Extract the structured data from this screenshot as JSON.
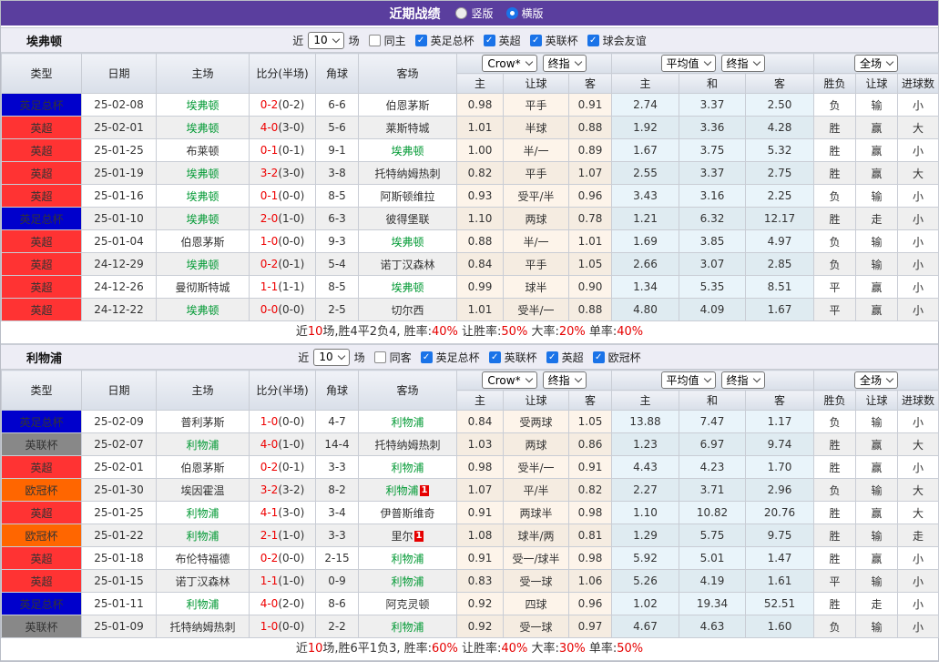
{
  "header": {
    "title": "近期战绩",
    "radio_vertical": "竖版",
    "radio_horizontal": "横版",
    "vertical_checked": false,
    "horizontal_checked": true
  },
  "table": {
    "columns_left": [
      "类型",
      "日期",
      "主场",
      "比分(半场)",
      "角球",
      "客场"
    ],
    "columns_sub": [
      "主",
      "让球",
      "客",
      "主",
      "和",
      "客",
      "胜负",
      "让球",
      "进球数"
    ],
    "selects": {
      "odds_group": [
        "Crow*",
        "终指"
      ],
      "avg_group": [
        "平均值",
        "终指"
      ],
      "scope_group": [
        "全场"
      ]
    }
  },
  "league_colors": {
    "英足总杯": "#0000cc",
    "英超": "#ff3333",
    "英联杯": "#888888",
    "欧冠杯": "#ff6600"
  },
  "result_colors": {
    "r": "#e60000",
    "b": "#3333cc",
    "g": "#009933"
  },
  "sections": [
    {
      "team": "埃弗顿",
      "filter": {
        "near": "近",
        "count": "10",
        "unit": "场",
        "same": "同主",
        "same_checked": false,
        "leagues": [
          "英足总杯",
          "英超",
          "英联杯",
          "球会友谊"
        ]
      },
      "rows": [
        {
          "league": "英足总杯",
          "date": "25-02-08",
          "home": "埃弗顿",
          "home_hl": true,
          "home_tag": "",
          "score": "0-2",
          "half": "(0-2)",
          "corners": "6-6",
          "away": "伯恩茅斯",
          "away_hl": false,
          "away_tag": "",
          "odds": [
            "0.98",
            "平手",
            "0.91"
          ],
          "avg": [
            "2.74",
            "3.37",
            "2.50"
          ],
          "res": [
            [
              "负",
              "b"
            ],
            [
              "输",
              "b"
            ],
            [
              "小",
              "b"
            ]
          ]
        },
        {
          "league": "英超",
          "date": "25-02-01",
          "home": "埃弗顿",
          "home_hl": true,
          "home_tag": "",
          "score": "4-0",
          "half": "(3-0)",
          "corners": "5-6",
          "away": "莱斯特城",
          "away_hl": false,
          "away_tag": "",
          "odds": [
            "1.01",
            "半球",
            "0.88"
          ],
          "avg": [
            "1.92",
            "3.36",
            "4.28"
          ],
          "res": [
            [
              "胜",
              "r"
            ],
            [
              "赢",
              "r"
            ],
            [
              "大",
              "r"
            ]
          ]
        },
        {
          "league": "英超",
          "date": "25-01-25",
          "home": "布莱顿",
          "home_hl": false,
          "home_tag": "",
          "score": "0-1",
          "half": "(0-1)",
          "corners": "9-1",
          "away": "埃弗顿",
          "away_hl": true,
          "away_tag": "",
          "odds": [
            "1.00",
            "半/一",
            "0.89"
          ],
          "avg": [
            "1.67",
            "3.75",
            "5.32"
          ],
          "res": [
            [
              "胜",
              "r"
            ],
            [
              "赢",
              "r"
            ],
            [
              "小",
              "b"
            ]
          ]
        },
        {
          "league": "英超",
          "date": "25-01-19",
          "home": "埃弗顿",
          "home_hl": true,
          "home_tag": "",
          "score": "3-2",
          "half": "(3-0)",
          "corners": "3-8",
          "away": "托特纳姆热刺",
          "away_hl": false,
          "away_tag": "",
          "odds": [
            "0.82",
            "平手",
            "1.07"
          ],
          "avg": [
            "2.55",
            "3.37",
            "2.75"
          ],
          "res": [
            [
              "胜",
              "r"
            ],
            [
              "赢",
              "r"
            ],
            [
              "大",
              "r"
            ]
          ]
        },
        {
          "league": "英超",
          "date": "25-01-16",
          "home": "埃弗顿",
          "home_hl": true,
          "home_tag": "",
          "score": "0-1",
          "half": "(0-0)",
          "corners": "8-5",
          "away": "阿斯顿维拉",
          "away_hl": false,
          "away_tag": "",
          "odds": [
            "0.93",
            "受平/半",
            "0.96"
          ],
          "avg": [
            "3.43",
            "3.16",
            "2.25"
          ],
          "res": [
            [
              "负",
              "b"
            ],
            [
              "输",
              "b"
            ],
            [
              "小",
              "b"
            ]
          ]
        },
        {
          "league": "英足总杯",
          "date": "25-01-10",
          "home": "埃弗顿",
          "home_hl": true,
          "home_tag": "",
          "score": "2-0",
          "half": "(1-0)",
          "corners": "6-3",
          "away": "彼得堡联",
          "away_hl": false,
          "away_tag": "",
          "odds": [
            "1.10",
            "两球",
            "0.78"
          ],
          "avg": [
            "1.21",
            "6.32",
            "12.17"
          ],
          "res": [
            [
              "胜",
              "r"
            ],
            [
              "走",
              "g"
            ],
            [
              "小",
              "b"
            ]
          ]
        },
        {
          "league": "英超",
          "date": "25-01-04",
          "home": "伯恩茅斯",
          "home_hl": false,
          "home_tag": "",
          "score": "1-0",
          "half": "(0-0)",
          "corners": "9-3",
          "away": "埃弗顿",
          "away_hl": true,
          "away_tag": "",
          "odds": [
            "0.88",
            "半/一",
            "1.01"
          ],
          "avg": [
            "1.69",
            "3.85",
            "4.97"
          ],
          "res": [
            [
              "负",
              "b"
            ],
            [
              "输",
              "b"
            ],
            [
              "小",
              "b"
            ]
          ]
        },
        {
          "league": "英超",
          "date": "24-12-29",
          "home": "埃弗顿",
          "home_hl": true,
          "home_tag": "",
          "score": "0-2",
          "half": "(0-1)",
          "corners": "5-4",
          "away": "诺丁汉森林",
          "away_hl": false,
          "away_tag": "",
          "odds": [
            "0.84",
            "平手",
            "1.05"
          ],
          "avg": [
            "2.66",
            "3.07",
            "2.85"
          ],
          "res": [
            [
              "负",
              "b"
            ],
            [
              "输",
              "b"
            ],
            [
              "小",
              "b"
            ]
          ]
        },
        {
          "league": "英超",
          "date": "24-12-26",
          "home": "曼彻斯特城",
          "home_hl": false,
          "home_tag": "",
          "score": "1-1",
          "half": "(1-1)",
          "corners": "8-5",
          "away": "埃弗顿",
          "away_hl": true,
          "away_tag": "",
          "odds": [
            "0.99",
            "球半",
            "0.90"
          ],
          "avg": [
            "1.34",
            "5.35",
            "8.51"
          ],
          "res": [
            [
              "平",
              "g"
            ],
            [
              "赢",
              "r"
            ],
            [
              "小",
              "b"
            ]
          ]
        },
        {
          "league": "英超",
          "date": "24-12-22",
          "home": "埃弗顿",
          "home_hl": true,
          "home_tag": "",
          "score": "0-0",
          "half": "(0-0)",
          "corners": "2-5",
          "away": "切尔西",
          "away_hl": false,
          "away_tag": "",
          "odds": [
            "1.01",
            "受半/一",
            "0.88"
          ],
          "avg": [
            "4.80",
            "4.09",
            "1.67"
          ],
          "res": [
            [
              "平",
              "g"
            ],
            [
              "赢",
              "r"
            ],
            [
              "小",
              "b"
            ]
          ]
        }
      ],
      "summary": [
        [
          "近",
          0
        ],
        [
          "10",
          1
        ],
        [
          "场,胜4平2负4, 胜率:",
          0
        ],
        [
          "40%",
          1
        ],
        [
          " 让胜率:",
          0
        ],
        [
          "50%",
          1
        ],
        [
          " 大率:",
          0
        ],
        [
          "20%",
          1
        ],
        [
          " 单率:",
          0
        ],
        [
          "40%",
          1
        ]
      ]
    },
    {
      "team": "利物浦",
      "filter": {
        "near": "近",
        "count": "10",
        "unit": "场",
        "same": "同客",
        "same_checked": false,
        "leagues": [
          "英足总杯",
          "英联杯",
          "英超",
          "欧冠杯"
        ]
      },
      "rows": [
        {
          "league": "英足总杯",
          "date": "25-02-09",
          "home": "普利茅斯",
          "home_hl": false,
          "home_tag": "",
          "score": "1-0",
          "half": "(0-0)",
          "corners": "4-7",
          "away": "利物浦",
          "away_hl": true,
          "away_tag": "",
          "odds": [
            "0.84",
            "受两球",
            "1.05"
          ],
          "avg": [
            "13.88",
            "7.47",
            "1.17"
          ],
          "res": [
            [
              "负",
              "b"
            ],
            [
              "输",
              "b"
            ],
            [
              "小",
              "b"
            ]
          ]
        },
        {
          "league": "英联杯",
          "date": "25-02-07",
          "home": "利物浦",
          "home_hl": true,
          "home_tag": "",
          "score": "4-0",
          "half": "(1-0)",
          "corners": "14-4",
          "away": "托特纳姆热刺",
          "away_hl": false,
          "away_tag": "",
          "odds": [
            "1.03",
            "两球",
            "0.86"
          ],
          "avg": [
            "1.23",
            "6.97",
            "9.74"
          ],
          "res": [
            [
              "胜",
              "r"
            ],
            [
              "赢",
              "r"
            ],
            [
              "大",
              "r"
            ]
          ]
        },
        {
          "league": "英超",
          "date": "25-02-01",
          "home": "伯恩茅斯",
          "home_hl": false,
          "home_tag": "",
          "score": "0-2",
          "half": "(0-1)",
          "corners": "3-3",
          "away": "利物浦",
          "away_hl": true,
          "away_tag": "",
          "odds": [
            "0.98",
            "受半/一",
            "0.91"
          ],
          "avg": [
            "4.43",
            "4.23",
            "1.70"
          ],
          "res": [
            [
              "胜",
              "r"
            ],
            [
              "赢",
              "r"
            ],
            [
              "小",
              "b"
            ]
          ]
        },
        {
          "league": "欧冠杯",
          "date": "25-01-30",
          "home": "埃因霍温",
          "home_hl": false,
          "home_tag": "",
          "score": "3-2",
          "half": "(3-2)",
          "corners": "8-2",
          "away": "利物浦",
          "away_hl": true,
          "away_tag": "1",
          "odds": [
            "1.07",
            "平/半",
            "0.82"
          ],
          "avg": [
            "2.27",
            "3.71",
            "2.96"
          ],
          "res": [
            [
              "负",
              "b"
            ],
            [
              "输",
              "b"
            ],
            [
              "大",
              "r"
            ]
          ]
        },
        {
          "league": "英超",
          "date": "25-01-25",
          "home": "利物浦",
          "home_hl": true,
          "home_tag": "",
          "score": "4-1",
          "half": "(3-0)",
          "corners": "3-4",
          "away": "伊普斯维奇",
          "away_hl": false,
          "away_tag": "",
          "odds": [
            "0.91",
            "两球半",
            "0.98"
          ],
          "avg": [
            "1.10",
            "10.82",
            "20.76"
          ],
          "res": [
            [
              "胜",
              "r"
            ],
            [
              "赢",
              "r"
            ],
            [
              "大",
              "r"
            ]
          ]
        },
        {
          "league": "欧冠杯",
          "date": "25-01-22",
          "home": "利物浦",
          "home_hl": true,
          "home_tag": "",
          "score": "2-1",
          "half": "(1-0)",
          "corners": "3-3",
          "away": "里尔",
          "away_hl": false,
          "away_tag": "1",
          "odds": [
            "1.08",
            "球半/两",
            "0.81"
          ],
          "avg": [
            "1.29",
            "5.75",
            "9.75"
          ],
          "res": [
            [
              "胜",
              "r"
            ],
            [
              "输",
              "b"
            ],
            [
              "走",
              "g"
            ]
          ]
        },
        {
          "league": "英超",
          "date": "25-01-18",
          "home": "布伦特福德",
          "home_hl": false,
          "home_tag": "",
          "score": "0-2",
          "half": "(0-0)",
          "corners": "2-15",
          "away": "利物浦",
          "away_hl": true,
          "away_tag": "",
          "odds": [
            "0.91",
            "受一/球半",
            "0.98"
          ],
          "avg": [
            "5.92",
            "5.01",
            "1.47"
          ],
          "res": [
            [
              "胜",
              "r"
            ],
            [
              "赢",
              "r"
            ],
            [
              "小",
              "b"
            ]
          ]
        },
        {
          "league": "英超",
          "date": "25-01-15",
          "home": "诺丁汉森林",
          "home_hl": false,
          "home_tag": "",
          "score": "1-1",
          "half": "(1-0)",
          "corners": "0-9",
          "away": "利物浦",
          "away_hl": true,
          "away_tag": "",
          "odds": [
            "0.83",
            "受一球",
            "1.06"
          ],
          "avg": [
            "5.26",
            "4.19",
            "1.61"
          ],
          "res": [
            [
              "平",
              "g"
            ],
            [
              "输",
              "b"
            ],
            [
              "小",
              "b"
            ]
          ]
        },
        {
          "league": "英足总杯",
          "date": "25-01-11",
          "home": "利物浦",
          "home_hl": true,
          "home_tag": "",
          "score": "4-0",
          "half": "(2-0)",
          "corners": "8-6",
          "away": "阿克灵顿",
          "away_hl": false,
          "away_tag": "",
          "odds": [
            "0.92",
            "四球",
            "0.96"
          ],
          "avg": [
            "1.02",
            "19.34",
            "52.51"
          ],
          "res": [
            [
              "胜",
              "r"
            ],
            [
              "走",
              "g"
            ],
            [
              "小",
              "b"
            ]
          ]
        },
        {
          "league": "英联杯",
          "date": "25-01-09",
          "home": "托特纳姆热刺",
          "home_hl": false,
          "home_tag": "",
          "score": "1-0",
          "half": "(0-0)",
          "corners": "2-2",
          "away": "利物浦",
          "away_hl": true,
          "away_tag": "",
          "odds": [
            "0.92",
            "受一球",
            "0.97"
          ],
          "avg": [
            "4.67",
            "4.63",
            "1.60"
          ],
          "res": [
            [
              "负",
              "b"
            ],
            [
              "输",
              "b"
            ],
            [
              "小",
              "b"
            ]
          ]
        }
      ],
      "summary": [
        [
          "近",
          0
        ],
        [
          "10",
          1
        ],
        [
          "场,胜6平1负3, 胜率:",
          0
        ],
        [
          "60%",
          1
        ],
        [
          " 让胜率:",
          0
        ],
        [
          "40%",
          1
        ],
        [
          " 大率:",
          0
        ],
        [
          "30%",
          1
        ],
        [
          " 单率:",
          0
        ],
        [
          "50%",
          1
        ]
      ]
    }
  ]
}
